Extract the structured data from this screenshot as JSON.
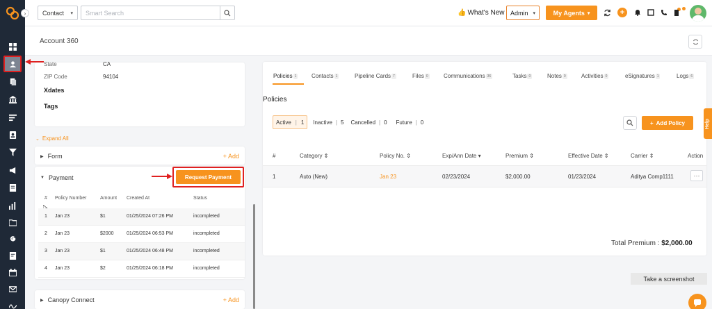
{
  "topbar": {
    "context_select": "Contact",
    "search_placeholder": "Smart Search",
    "whats_new": "What's New",
    "admin_select": "Admin",
    "my_agents": "My Agents"
  },
  "page": {
    "title": "Account 360"
  },
  "details": {
    "state_label": "State",
    "state_value": "CA",
    "zip_label": "ZIP Code",
    "zip_value": "94104",
    "xdates": "Xdates",
    "tags": "Tags"
  },
  "expand_all": "Expand All",
  "sections": {
    "form": {
      "title": "Form",
      "add": "Add"
    },
    "payment": {
      "title": "Payment",
      "request_button": "Request Payment"
    },
    "canopy": {
      "title": "Canopy Connect",
      "add": "Add"
    }
  },
  "payment_table": {
    "headers": [
      "#",
      "Policy Number",
      "Amount",
      "Created At",
      "Status"
    ],
    "rows": [
      [
        "1",
        "Jan 23",
        "$1",
        "01/25/2024 07:26 PM",
        "incompleted"
      ],
      [
        "2",
        "Jan 23",
        "$2000",
        "01/25/2024 06:53 PM",
        "incompleted"
      ],
      [
        "3",
        "Jan 23",
        "$1",
        "01/25/2024 06:48 PM",
        "incompleted"
      ],
      [
        "4",
        "Jan 23",
        "$2",
        "01/25/2024 06:18 PM",
        "incompleted"
      ]
    ]
  },
  "tabs": [
    {
      "label": "Policies",
      "count": "1"
    },
    {
      "label": "Contacts",
      "count": "1"
    },
    {
      "label": "Pipeline Cards",
      "count": "7"
    },
    {
      "label": "Files",
      "count": "0"
    },
    {
      "label": "Communications",
      "count": "36"
    },
    {
      "label": "Tasks",
      "count": "0"
    },
    {
      "label": "Notes",
      "count": "0"
    },
    {
      "label": "Activities",
      "count": "0"
    },
    {
      "label": "eSignatures",
      "count": "1"
    },
    {
      "label": "Logs",
      "count": "6"
    }
  ],
  "policies": {
    "title": "Policies",
    "filters": {
      "active": "Active",
      "active_count": "1",
      "inactive": "Inactive",
      "inactive_count": "5",
      "cancelled": "Cancelled",
      "cancelled_count": "0",
      "future": "Future",
      "future_count": "0"
    },
    "add_button": "Add Policy",
    "headers": {
      "num": "#",
      "category": "Category",
      "policy_no": "Policy No.",
      "exp_date": "Exp/Ann Date",
      "premium": "Premium",
      "effective_date": "Effective Date",
      "carrier": "Carrier",
      "action": "Action"
    },
    "row": {
      "num": "1",
      "category": "Auto (New)",
      "policy_no": "Jan 23",
      "exp_date": "02/23/2024",
      "premium": "$2,000.00",
      "effective_date": "01/23/2024",
      "carrier": "Aditya Comp1111",
      "action": "···"
    },
    "total_label": "Total Premium :",
    "total_value": "$2,000.00"
  },
  "help": "Help",
  "screenshot_tip": "Take a screenshot",
  "colors": {
    "accent": "#f7931e",
    "sidebar": "#1f2937",
    "highlight": "#e02020"
  }
}
